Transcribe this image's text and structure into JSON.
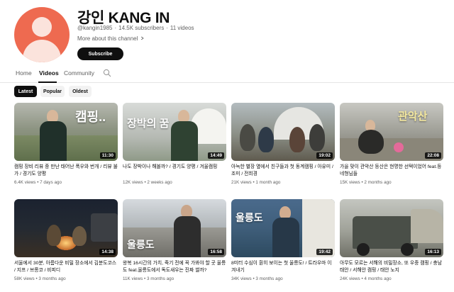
{
  "channel": {
    "title": "강인 KANG IN",
    "handle": "@kangin1985",
    "subscribers": "14.5K subscribers",
    "video_count": "11 videos",
    "about_label": "More about this channel",
    "subscribe_label": "Subscribe",
    "avatar_color": "#ee6a50"
  },
  "tabs": [
    {
      "label": "Home"
    },
    {
      "label": "Videos",
      "active": true
    },
    {
      "label": "Community"
    }
  ],
  "chips": [
    {
      "label": "Latest",
      "active": true
    },
    {
      "label": "Popular"
    },
    {
      "label": "Oldest"
    }
  ],
  "videos": [
    {
      "title": "캠핑 장비 리뷰 중 만난 태어난 폭우와 번개 / 리뷰 불가 / 경기도 양평",
      "views": "6.4K views",
      "age": "7 days ago",
      "duration": "11:30",
      "overlay": "캠핑.."
    },
    {
      "title": "나도 장박이나 해볼까? / 경기도 양평 / 겨울캠핑",
      "views": "12K views",
      "age": "2 weeks ago",
      "duration": "14:49",
      "overlay": "장박의 꿈"
    },
    {
      "title": "아늑한 별장 옆에서 친구들과 첫 동계캠핑 / 아유미 / 조미 / 전희경",
      "views": "21K views",
      "age": "1 month ago",
      "duration": "19:02",
      "overlay": ""
    },
    {
      "title": "가을 맞이 관악산 등산은 현명한 선택이었어 feat.등네형님들",
      "views": "15K views",
      "age": "2 months ago",
      "duration": "22:08",
      "overlay": "관악산"
    },
    {
      "title": "서울에서 30분, 아름다운 비밀 장소에서 김분도코스 / 지프 / 브롱코 / 비피디",
      "views": "58K views",
      "age": "3 months ago",
      "duration": "14:38",
      "overlay": ""
    },
    {
      "title": "왕복 16시간의 가치, 죽기 전에 꼭 가봐야 할 곳 울릉도 feat.울릉도에서 독도새우는 진짜 썰까?",
      "views": "11K views",
      "age": "3 months ago",
      "duration": "16:58",
      "overlay": "울릉도"
    },
    {
      "title": "8미터 수심이 훤히 보이는 첫 울릉도! / 트라우마 이겨내기",
      "views": "34K views",
      "age": "3 months ago",
      "duration": "19:42",
      "overlay": "울릉도"
    },
    {
      "title": "아무도 모르는 서해의 비밀장소, 또 우중 캠핑 / 충남 태안 / 서해안 캠핑 / 태안 노지",
      "views": "24K views",
      "age": "4 months ago",
      "duration": "16:13",
      "overlay": ""
    }
  ]
}
